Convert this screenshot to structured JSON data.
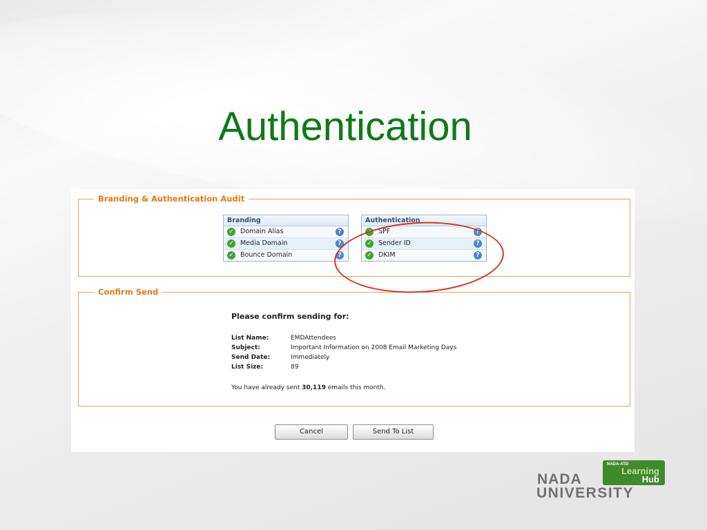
{
  "slide": {
    "title": "Authentication"
  },
  "audit": {
    "legend": "Branding & Authentication Audit",
    "branding": {
      "header": "Branding",
      "rows": [
        "Domain Alias",
        "Media Domain",
        "Bounce Domain"
      ]
    },
    "authentication": {
      "header": "Authentication",
      "rows": [
        "SPF",
        "Sender ID",
        "DKIM"
      ]
    }
  },
  "confirm": {
    "legend": "Confirm Send",
    "heading": "Please confirm sending for:",
    "fields": [
      {
        "label": "List Name:",
        "value": "EMDAttendees"
      },
      {
        "label": "Subject:",
        "value": "Important Information on 2008 Email Marketing Days"
      },
      {
        "label": "Send Date:",
        "value": "Immediately"
      },
      {
        "label": "List Size:",
        "value": "89"
      }
    ],
    "sent_prefix": "You have already sent ",
    "sent_count": "30,119",
    "sent_suffix": " emails this month."
  },
  "buttons": {
    "cancel": "Cancel",
    "send": "Send To List"
  },
  "logo": {
    "line1": "NADA",
    "line2": "UNIVERSITY",
    "badge_top": "NADA-ATD",
    "badge_learning": "Learning",
    "badge_hub": "Hub"
  },
  "colors": {
    "title": "#0d7a18",
    "accent": "#e37a17",
    "annotation": "#d8341f",
    "check": "#3fa62f",
    "help": "#4a86c8"
  }
}
